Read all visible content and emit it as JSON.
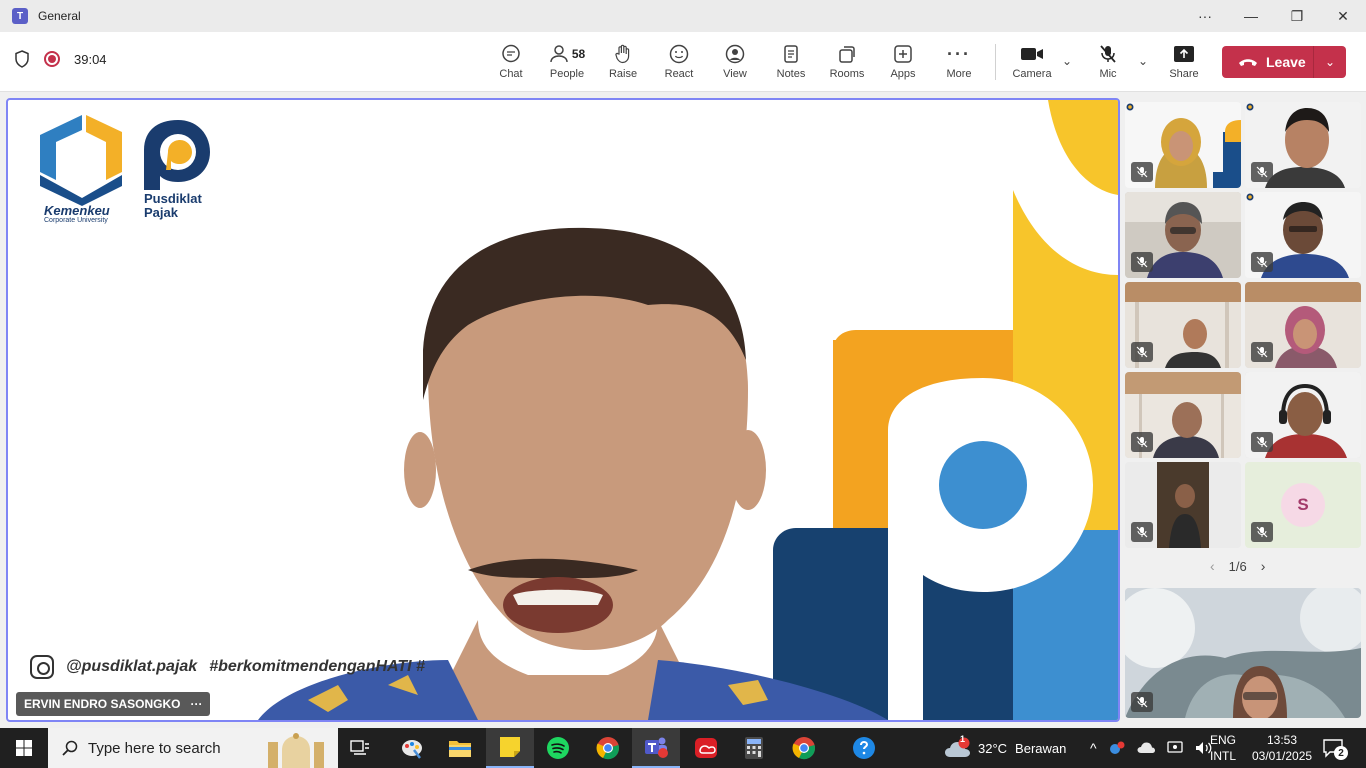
{
  "window": {
    "title": "General"
  },
  "meeting": {
    "timer": "39:04",
    "people_count": "58",
    "toolbar": {
      "chat": "Chat",
      "people": "People",
      "raise": "Raise",
      "react": "React",
      "view": "View",
      "notes": "Notes",
      "rooms": "Rooms",
      "apps": "Apps",
      "more": "More",
      "camera": "Camera",
      "mic": "Mic",
      "share": "Share"
    },
    "leave_label": "Leave",
    "leave_color": "#c4314b",
    "accent_color": "#7f85f5"
  },
  "main_video": {
    "speaker_name": "ERVIN ENDRO SASONGKO",
    "name_more": "···",
    "logo_kemenkeu": "Kemenkeu",
    "logo_kemenkeu_sub": "Corporate University",
    "logo_pusdiklat_line1": "Pusdiklat",
    "logo_pusdiklat_line2": "Pajak",
    "instagram": "@pusdiklat.pajak",
    "hashtag": "#berkomitmendenganHATI  #"
  },
  "gallery": {
    "avatar_initial": "S",
    "page_indicator": "1/6"
  },
  "taskbar": {
    "search_placeholder": "Type here to search",
    "weather_temp": "32°C",
    "weather_text": "Berawan",
    "weather_badge": "1",
    "lang_line1": "ENG",
    "lang_line2": "INTL",
    "time": "13:53",
    "date": "03/01/2025",
    "notifications": "2"
  }
}
